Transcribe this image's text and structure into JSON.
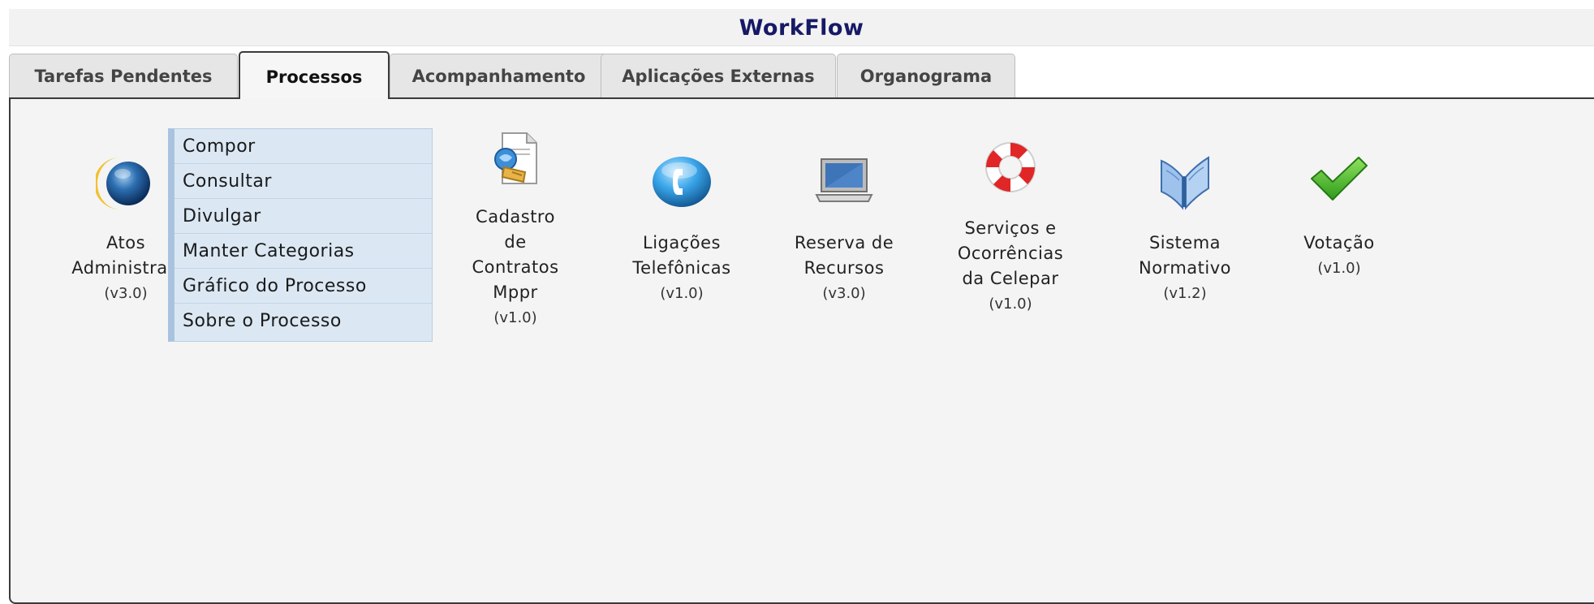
{
  "app": {
    "title": "WorkFlow"
  },
  "tabs": [
    {
      "label": "Tarefas Pendentes",
      "active": false
    },
    {
      "label": "Processos",
      "active": true
    },
    {
      "label": "Acompanhamento",
      "active": false
    },
    {
      "label": "Aplicações Externas",
      "active": false
    },
    {
      "label": "Organograma",
      "active": false
    }
  ],
  "processes": [
    {
      "name": "Atos\nAdministrati",
      "version": "(v3.0)",
      "icon": "globe-icon"
    },
    {
      "name": "Cadastro\nde\nContratos\nMppr",
      "version": "(v1.0)",
      "icon": "contract-document-icon"
    },
    {
      "name": "Ligações\nTelefônicas",
      "version": "(v1.0)",
      "icon": "phone-icon"
    },
    {
      "name": "Reserva de\nRecursos",
      "version": "(v3.0)",
      "icon": "laptop-icon"
    },
    {
      "name": "Serviços e\nOcorrências\nda Celepar",
      "version": "(v1.0)",
      "icon": "lifebuoy-icon"
    },
    {
      "name": "Sistema\nNormativo",
      "version": "(v1.2)",
      "icon": "book-icon"
    },
    {
      "name": "Votação",
      "version": "(v1.0)",
      "icon": "checkmark-icon"
    }
  ],
  "context_menu": {
    "items": [
      "Compor",
      "Consultar",
      "Divulgar",
      "Manter Categorias",
      "Gráfico do Processo",
      "Sobre o Processo"
    ]
  },
  "colors": {
    "title": "#161a66",
    "menu_bg": "#dbe8f4",
    "menu_accent": "#a9c3df",
    "panel_bg": "#f4f4f4"
  }
}
